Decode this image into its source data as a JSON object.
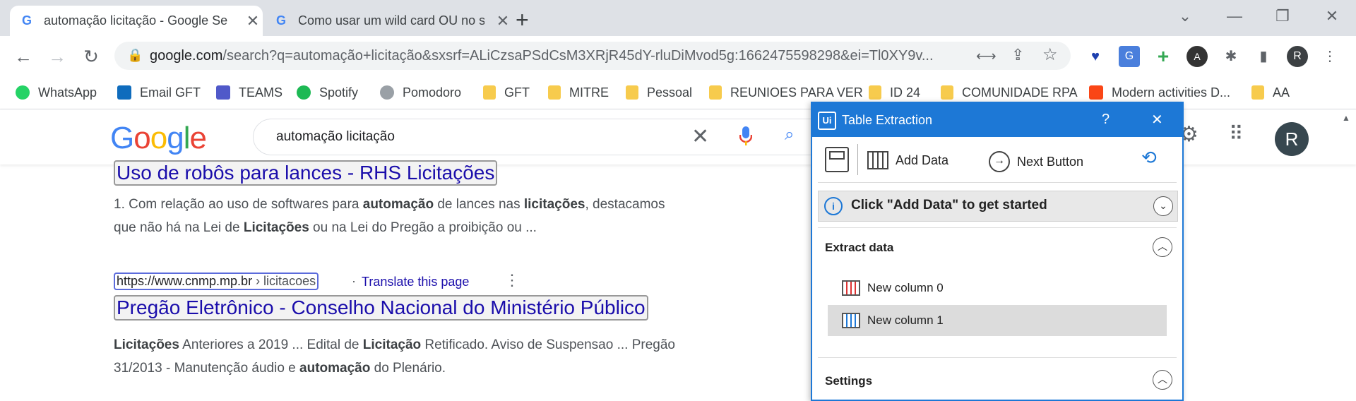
{
  "browser": {
    "tabs": [
      {
        "title": "automação licitação - Google Se",
        "favicon": "G"
      },
      {
        "title": "Como usar um wild card OU no s",
        "favicon": "G"
      }
    ],
    "new_tab": "+",
    "address": {
      "host": "google.com",
      "path": "/search?q=automação+licitação&sxsrf=ALiCzsaPSdCsM3XRjR45dY-rluDiMvod5g:1662475598298&ei=Tl0XY9v..."
    },
    "profile_initial": "R",
    "bookmarks": [
      {
        "label": "WhatsApp",
        "icon": "whatsapp-icon",
        "color": "#25d366"
      },
      {
        "label": "Email GFT",
        "icon": "outlook-icon",
        "color": "#0f6cbd"
      },
      {
        "label": "TEAMS",
        "icon": "teams-icon",
        "color": "#5059c9"
      },
      {
        "label": "Spotify",
        "icon": "spotify-icon",
        "color": "#1db954"
      },
      {
        "label": "Pomodoro",
        "icon": "check-icon",
        "color": "#9aa0a6"
      },
      {
        "label": "GFT",
        "icon": "folder-icon",
        "color": "#f7cb4d"
      },
      {
        "label": "MITRE",
        "icon": "folder-icon",
        "color": "#f7cb4d"
      },
      {
        "label": "Pessoal",
        "icon": "folder-icon",
        "color": "#f7cb4d"
      },
      {
        "label": "REUNIOES PARA VER",
        "icon": "folder-icon",
        "color": "#f7cb4d"
      },
      {
        "label": "ID 24",
        "icon": "folder-icon",
        "color": "#f7cb4d"
      },
      {
        "label": "COMUNIDADE RPA",
        "icon": "folder-icon",
        "color": "#f7cb4d"
      },
      {
        "label": "Modern activities D...",
        "icon": "uipath-icon",
        "color": "#fa4616"
      },
      {
        "label": "AA",
        "icon": "folder-icon",
        "color": "#f7cb4d"
      }
    ]
  },
  "google": {
    "query": "automação licitação",
    "profile_initial": "R"
  },
  "results": {
    "r1_title": "Uso de robôs para lances - RHS Licitações",
    "r1_snip_a": "1. Com relação ao uso de softwares para ",
    "r1_b1": "automação",
    "r1_snip_b": " de lances nas ",
    "r1_b2": "licitações",
    "r1_snip_c": ", destacamos",
    "r1_line2_a": "que não há na Lei de ",
    "r1_b3": "Licitações",
    "r1_line2_b": " ou na Lei do Pregão a proibição ou ...",
    "r2_url": "https://www.cnmp.mp.br",
    "r2_crumb": " › licitacoes",
    "r2_translate": "Translate this page",
    "r2_title": "Pregão Eletrônico - Conselho Nacional do Ministério Público",
    "r2_b1": "Licitações",
    "r2_snip_a": " Anteriores a 2019 ... Edital de ",
    "r2_b2": "Licitação",
    "r2_snip_b": " Retificado. Aviso de Suspensao ... Pregão",
    "r2_line2_a": "31/2013 - Manutenção áudio e ",
    "r2_b3": "automação",
    "r2_line2_b": " do Plenário."
  },
  "panel": {
    "title": "Table Extraction",
    "logo": "Ui",
    "help": "?",
    "close": "✕",
    "add_data": "Add Data",
    "next_button": "Next Button",
    "banner": "Click \"Add Data\" to get started",
    "extract_header": "Extract data",
    "columns": [
      "New column 0",
      "New column 1"
    ],
    "settings_header": "Settings",
    "accent": "#1d78d6"
  }
}
